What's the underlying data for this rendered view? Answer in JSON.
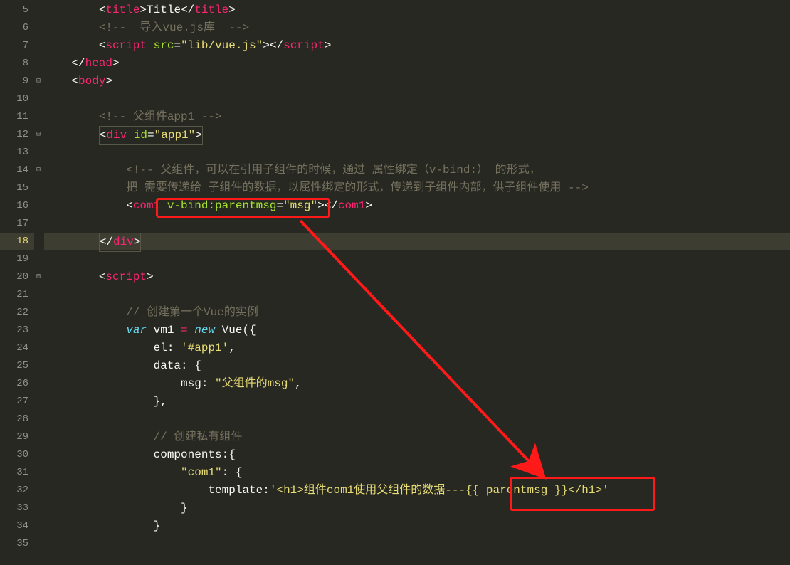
{
  "gutter": {
    "5": "5",
    "6": "6",
    "7": "7",
    "8": "8",
    "9": "9",
    "10": "10",
    "11": "11",
    "12": "12",
    "13": "13",
    "14": "14",
    "15": "15",
    "16": "16",
    "17": "17",
    "18": "18",
    "19": "19",
    "20": "20",
    "21": "21",
    "22": "22",
    "23": "23",
    "24": "24",
    "25": "25",
    "26": "26",
    "27": "27",
    "28": "28",
    "29": "29",
    "30": "30",
    "31": "31",
    "32": "32",
    "33": "33",
    "34": "34",
    "35": "35"
  },
  "fold": {
    "a": "⊟",
    "b": "⊟",
    "c": "⊟",
    "d": "⊟"
  },
  "code": {
    "l5a": "<",
    "l5b": "title",
    "l5c": ">",
    "l5d": "Title",
    "l5e": "</",
    "l5f": "title",
    "l5g": ">",
    "l6": "<!--  导入vue.js库  -->",
    "l7a": "<",
    "l7b": "script ",
    "l7c": "src",
    "l7d": "=",
    "l7e": "\"lib/vue.js\"",
    "l7f": "><",
    "l7g": "/",
    "l7h": "script",
    "l7i": ">",
    "l8a": "</",
    "l8b": "head",
    "l8c": ">",
    "l9a": "<",
    "l9b": "body",
    "l9c": ">",
    "l11": "<!-- 父组件app1 -->",
    "l12a": "<",
    "l12b": "div ",
    "l12c": "id",
    "l12d": "=",
    "l12e": "\"app1\"",
    "l12f": ">",
    "l14": "<!-- 父组件，可以在引用子组件的时候，通过 属性绑定（v-bind:） 的形式，",
    "l15": "把 需要传递给 子组件的数据，以属性绑定的形式，传递到子组件内部，供子组件使用 -->",
    "l16a": "<",
    "l16b": "com1 ",
    "l16c": "v-bind:parentmsg",
    "l16d": "=",
    "l16e": "\"msg\"",
    "l16f": "></",
    "l16g": "com1",
    "l16h": ">",
    "l18a": "</",
    "l18b": "div",
    "l18c": ">",
    "l20a": "<",
    "l20b": "script",
    "l20c": ">",
    "l22": "// 创建第一个Vue的实例",
    "l23a": "var",
    "l23b": " vm1 ",
    "l23c": "=",
    "l23d": " ",
    "l23e": "new",
    "l23f": " Vue",
    "l23g": "({",
    "l24a": "el: ",
    "l24b": "'#app1'",
    "l24c": ",",
    "l25a": "data: ",
    "l25b": "{",
    "l26a": "msg: ",
    "l26b": "\"父组件的msg\"",
    "l26c": ",",
    "l27": "},",
    "l29": "// 创建私有组件",
    "l30a": "components:",
    "l30b": "{",
    "l31a": "\"com1\"",
    "l31b": ": {",
    "l32a": "template:",
    "l32b": "'<h1>组件com1使用父组件的数据---{{ parentmsg }}</h1>'",
    "l33": "}",
    "l34": "}"
  }
}
